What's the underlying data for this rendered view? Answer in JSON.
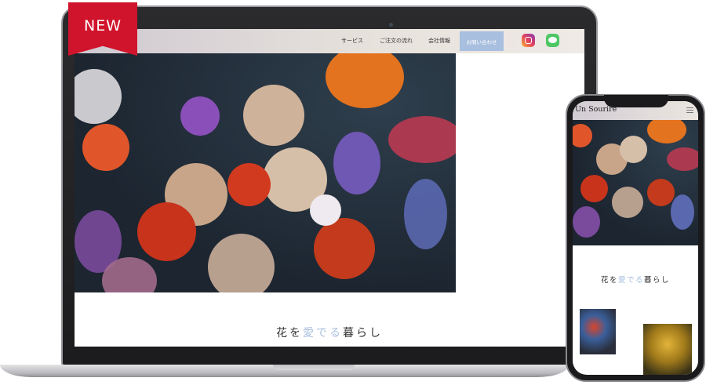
{
  "badge": {
    "label": "NEW"
  },
  "site": {
    "logo": "Un Sourire",
    "logo_partial": "rire",
    "nav": [
      {
        "label": "サービス"
      },
      {
        "label": "ご注文の流れ"
      },
      {
        "label": "会社情報"
      }
    ],
    "contact_label": "お問い合わせ",
    "social": [
      "instagram-icon",
      "line-icon"
    ],
    "tagline": {
      "part1": "花を",
      "accent": "愛でる",
      "part2": "暮らし"
    }
  },
  "colors": {
    "accent": "#a8bfdf",
    "ribbon": "#d0142c",
    "line": "#4cc764"
  }
}
